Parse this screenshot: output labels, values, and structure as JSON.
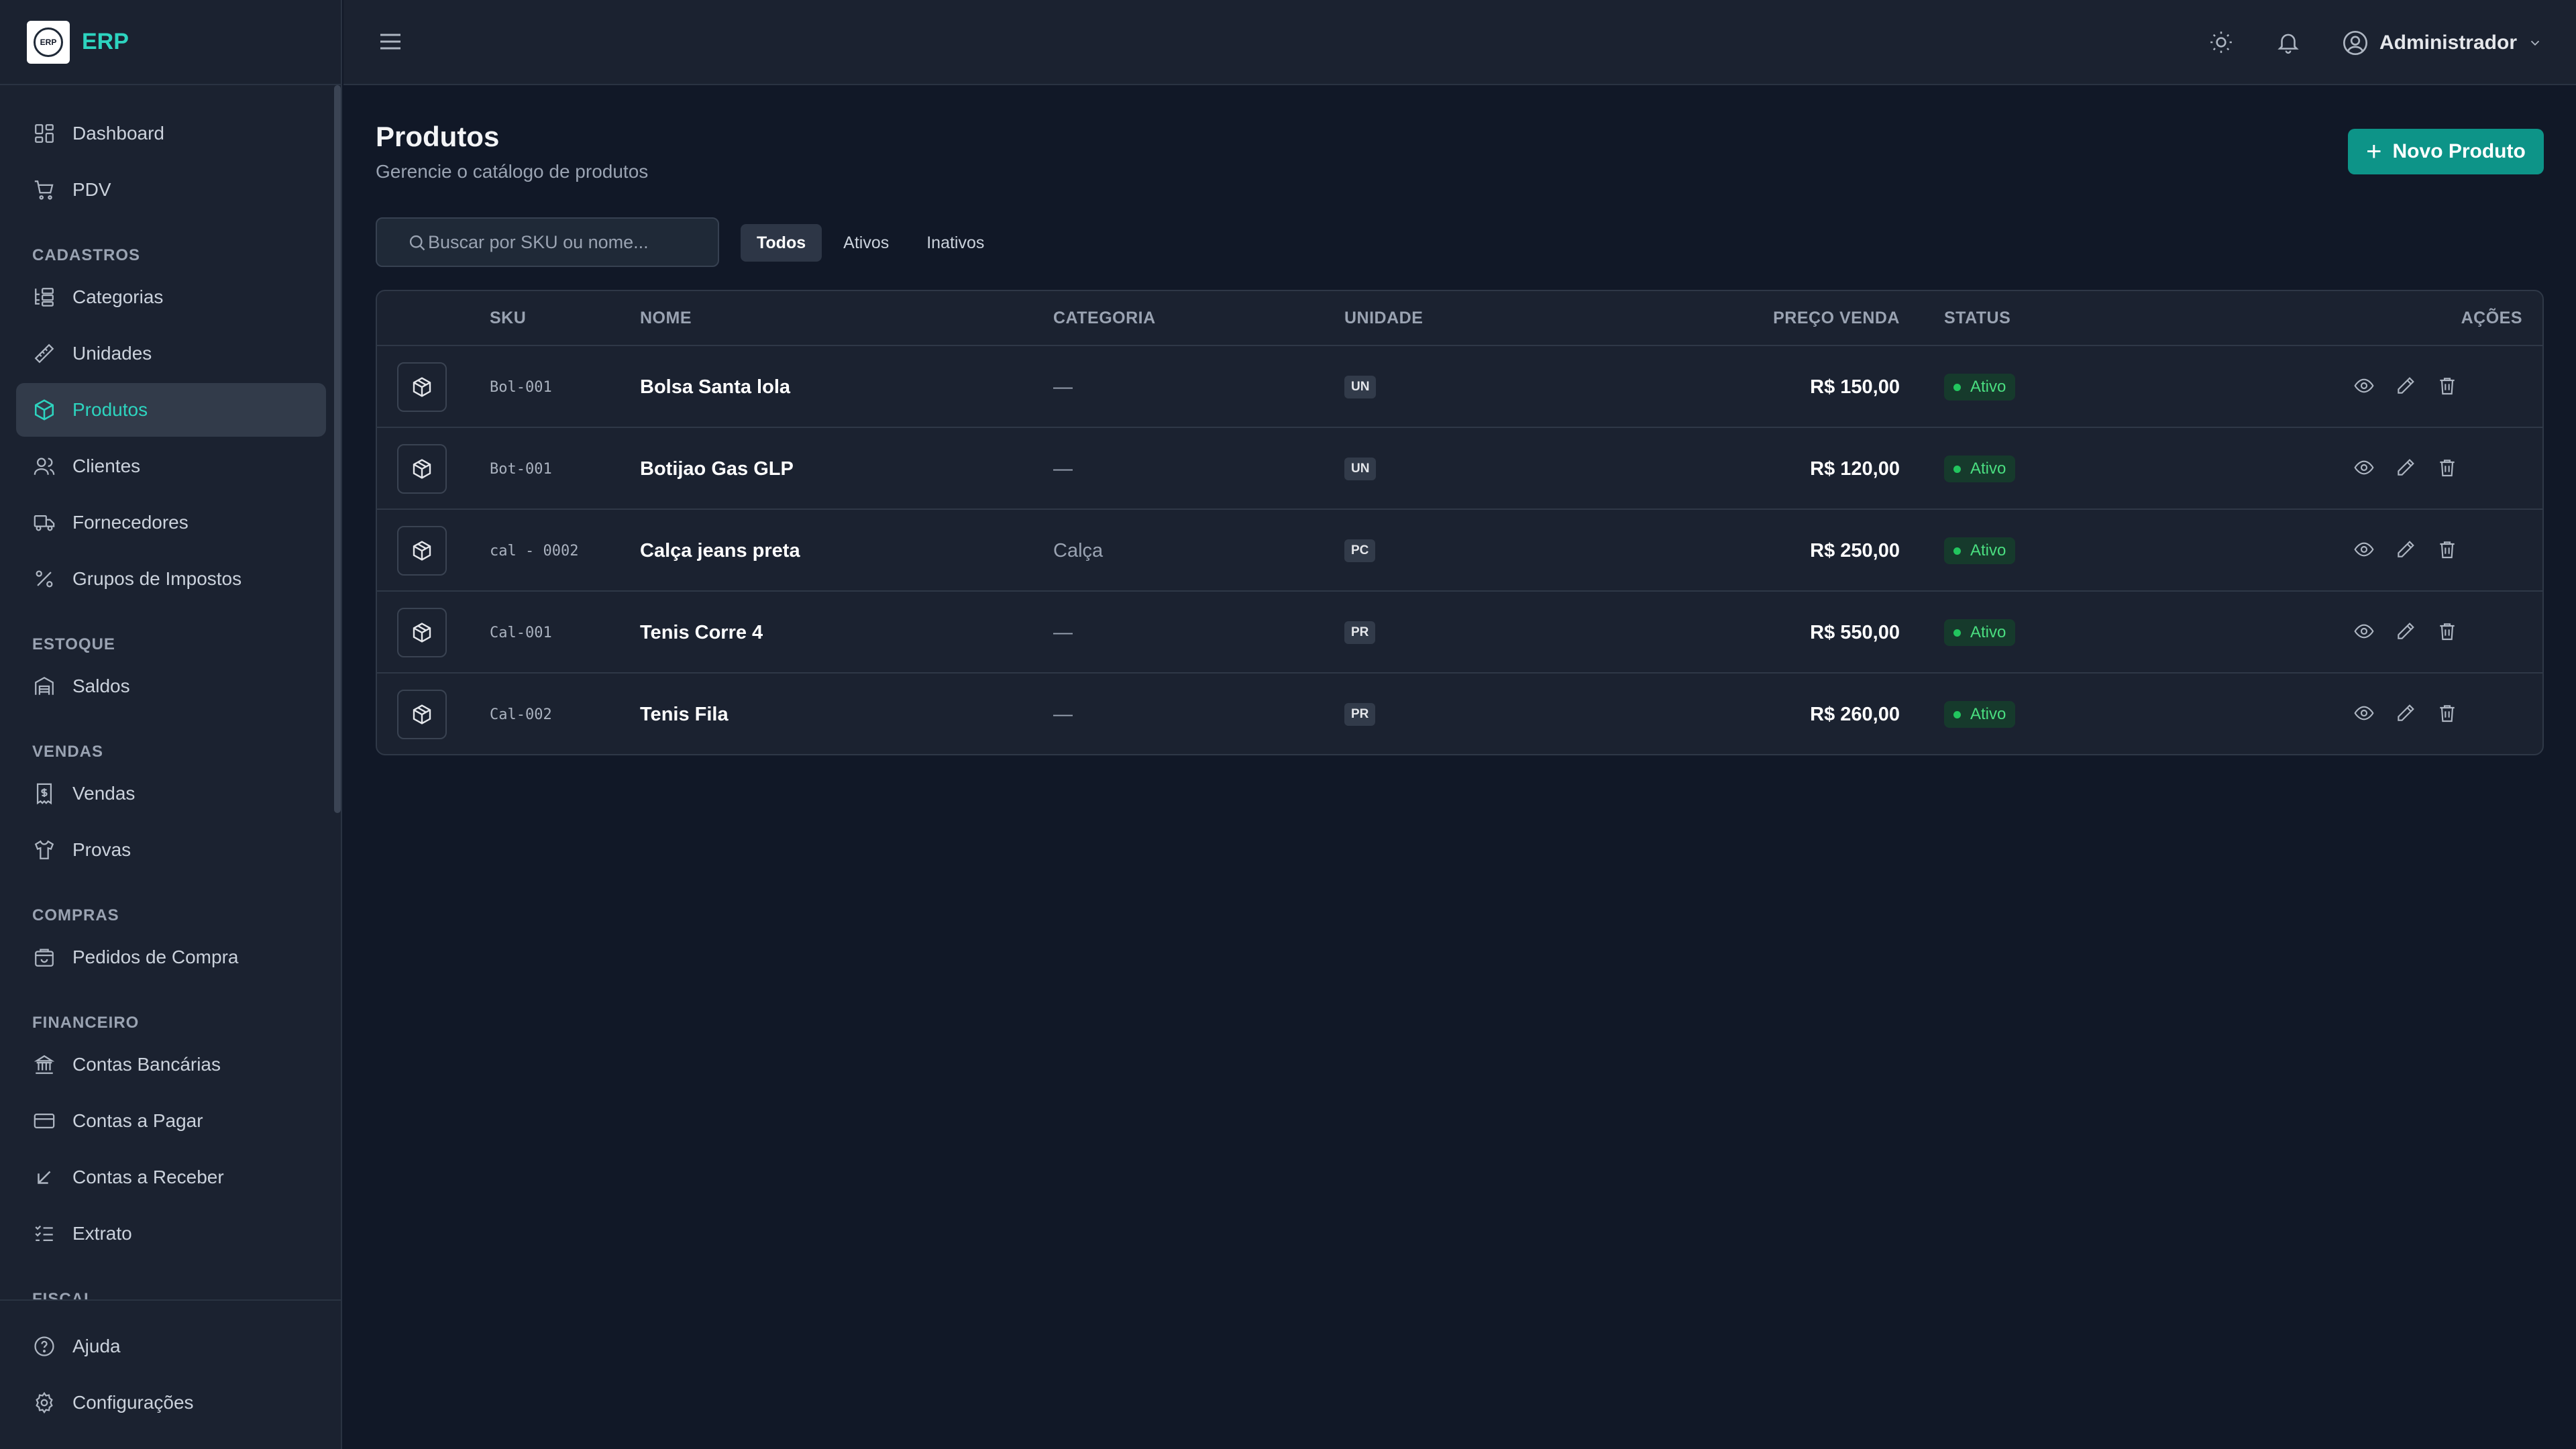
{
  "app": {
    "name": "ERP",
    "logo_text": "ERP"
  },
  "sidebar": {
    "items": [
      {
        "label": "Dashboard",
        "icon": "dashboard-icon"
      },
      {
        "label": "PDV",
        "icon": "cart-icon"
      }
    ],
    "sections": [
      {
        "title": "CADASTROS",
        "items": [
          {
            "label": "Categorias",
            "icon": "categories-icon"
          },
          {
            "label": "Unidades",
            "icon": "ruler-icon"
          },
          {
            "label": "Produtos",
            "icon": "box-icon",
            "active": true
          },
          {
            "label": "Clientes",
            "icon": "users-icon"
          },
          {
            "label": "Fornecedores",
            "icon": "truck-icon"
          },
          {
            "label": "Grupos de Impostos",
            "icon": "percent-icon"
          }
        ]
      },
      {
        "title": "ESTOQUE",
        "items": [
          {
            "label": "Saldos",
            "icon": "warehouse-icon"
          }
        ]
      },
      {
        "title": "VENDAS",
        "items": [
          {
            "label": "Vendas",
            "icon": "receipt-icon"
          },
          {
            "label": "Provas",
            "icon": "shirt-icon"
          }
        ]
      },
      {
        "title": "COMPRAS",
        "items": [
          {
            "label": "Pedidos de Compra",
            "icon": "shopping-bag-icon"
          }
        ]
      },
      {
        "title": "FINANCEIRO",
        "items": [
          {
            "label": "Contas Bancárias",
            "icon": "bank-icon"
          },
          {
            "label": "Contas a Pagar",
            "icon": "credit-card-icon"
          },
          {
            "label": "Contas a Receber",
            "icon": "arrow-down-left-icon"
          },
          {
            "label": "Extrato",
            "icon": "list-checks-icon"
          }
        ]
      },
      {
        "title": "FISCAL",
        "items": []
      }
    ],
    "bottom": [
      {
        "label": "Ajuda",
        "icon": "help-circle-icon"
      },
      {
        "label": "Configurações",
        "icon": "gear-icon"
      }
    ]
  },
  "header": {
    "user": "Administrador"
  },
  "page": {
    "title": "Produtos",
    "subtitle": "Gerencie o catálogo de produtos",
    "new_button": "Novo Produto",
    "search_placeholder": "Buscar por SKU ou nome...",
    "filters": [
      "Todos",
      "Ativos",
      "Inativos"
    ],
    "active_filter": "Todos"
  },
  "table": {
    "columns": [
      "SKU",
      "NOME",
      "CATEGORIA",
      "UNIDADE",
      "PREÇO VENDA",
      "STATUS",
      "AÇÕES"
    ],
    "rows": [
      {
        "sku": "Bol-001",
        "nome": "Bolsa Santa lola",
        "categoria": "—",
        "unidade": "UN",
        "preco": "R$ 150,00",
        "status": "Ativo"
      },
      {
        "sku": "Bot-001",
        "nome": "Botijao Gas GLP",
        "categoria": "—",
        "unidade": "UN",
        "preco": "R$ 120,00",
        "status": "Ativo"
      },
      {
        "sku": "cal - 0002",
        "nome": "Calça jeans preta",
        "categoria": "Calça",
        "unidade": "PC",
        "preco": "R$ 250,00",
        "status": "Ativo"
      },
      {
        "sku": "Cal-001",
        "nome": "Tenis Corre 4",
        "categoria": "—",
        "unidade": "PR",
        "preco": "R$ 550,00",
        "status": "Ativo"
      },
      {
        "sku": "Cal-002",
        "nome": "Tenis Fila",
        "categoria": "—",
        "unidade": "PR",
        "preco": "R$ 260,00",
        "status": "Ativo"
      }
    ]
  },
  "colors": {
    "accent": "#2dd4bf",
    "button": "#0d9488",
    "status_active": "#4ade80"
  }
}
